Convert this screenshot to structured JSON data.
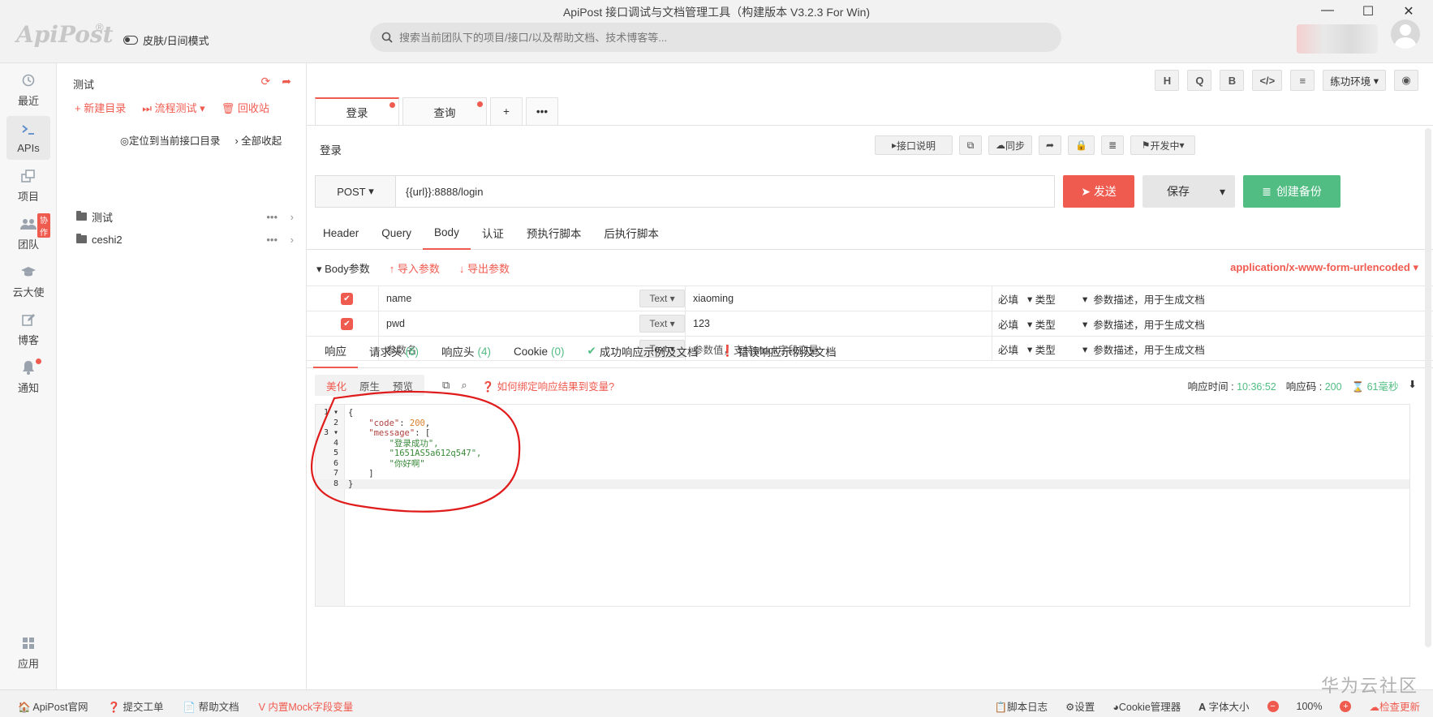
{
  "window": {
    "title": "ApiPost 接口调试与文档管理工具（构建版本 V3.2.3 For Win)",
    "minimize": "—",
    "maximize": "☐",
    "close": "✕"
  },
  "header": {
    "logo": "ApiPost",
    "logo_mark": "®",
    "skin_label": "皮肤/日间模式",
    "search_placeholder": "搜索当前团队下的项目/接口/以及帮助文档、技术博客等..."
  },
  "leftnav": {
    "items": [
      {
        "label": "最近",
        "icon": "clock-icon"
      },
      {
        "label": "APIs",
        "icon": "terminal-icon"
      },
      {
        "label": "项目",
        "icon": "project-icon"
      },
      {
        "label": "团队",
        "icon": "team-icon",
        "badge": "协作"
      },
      {
        "label": "云大使",
        "icon": "graduation-cap-icon"
      },
      {
        "label": "博客",
        "icon": "edit-icon"
      },
      {
        "label": "通知",
        "icon": "bell-icon"
      },
      {
        "label": "应用",
        "icon": "grid-icon"
      }
    ]
  },
  "tree": {
    "title": "测试",
    "new_dir": "新建目录",
    "flow_test": "流程测试",
    "recycle": "回收站",
    "locate": "定位到当前接口目录",
    "collapse": "全部收起",
    "folders": [
      "测试",
      "ceshi2"
    ]
  },
  "toolbar": {
    "buttons": [
      "H",
      "Q",
      "B",
      "</>",
      "≡"
    ],
    "env": "练功环境"
  },
  "tabs": [
    {
      "label": "登录"
    },
    {
      "label": "查询"
    }
  ],
  "tab_add": "+",
  "tab_more": "•••",
  "api": {
    "name": "登录",
    "doc_btn": "接口说明",
    "sync_btn": "同步",
    "status": "开发中",
    "method": "POST",
    "url": "{{url}}:8888/login",
    "send": "发送",
    "save": "保存",
    "backup": "创建备份"
  },
  "req_tabs": [
    "Header",
    "Query",
    "Body",
    "认证",
    "预执行脚本",
    "后执行脚本"
  ],
  "body": {
    "title": "Body参数",
    "import": "导入参数",
    "export": "导出参数",
    "content_type": "application/x-www-form-urlencoded",
    "rows": [
      {
        "checked": true,
        "name": "name",
        "type": "Text",
        "value": "xiaoming",
        "required": "必填",
        "vtype": "类型",
        "desc": "参数描述，用于生成文档"
      },
      {
        "checked": true,
        "name": "pwd",
        "type": "Text",
        "value": "123",
        "required": "必填",
        "vtype": "类型",
        "desc": "参数描述，用于生成文档"
      },
      {
        "checked": false,
        "name": "参数名",
        "type": "Text",
        "value": "参数值，支持Mock字段变量",
        "required": "必填",
        "vtype": "类型",
        "desc": "参数描述，用于生成文档"
      }
    ]
  },
  "resp_tabs": {
    "response": "响应",
    "req_headers": "请求头",
    "req_headers_count": "(6)",
    "resp_headers": "响应头",
    "resp_headers_count": "(4)",
    "cookie": "Cookie",
    "cookie_count": "(0)",
    "success_doc": "成功响应示例及文档",
    "error_doc": "错误响应示例及文档"
  },
  "view": {
    "modes": [
      "美化",
      "原生",
      "预览"
    ],
    "bind_help": "如何绑定响应结果到变量?",
    "time_label": "响应时间 : ",
    "time_value": "10:36:52",
    "code_label": "响应码 : ",
    "code_value": "200",
    "duration": "61毫秒"
  },
  "code_lines": [
    "{",
    "    \"code\": 200,",
    "    \"message\": [",
    "        \"登录成功\",",
    "        \"1651AS5a612q547\",",
    "        \"你好啊\"",
    "    ]",
    "}"
  ],
  "statusbar": {
    "official": "ApiPost官网",
    "ticket": "提交工单",
    "help": "帮助文档",
    "mock": "内置Mock字段变量",
    "script_log": "脚本日志",
    "settings": "设置",
    "cookie_mgr": "Cookie管理器",
    "font_size": "字体大小",
    "zoom": "100%",
    "update": "检查更新"
  },
  "watermark": "华为云社区",
  "colors": {
    "accent": "#f05b50",
    "success": "#52bd83",
    "annotation": "#e01b1b"
  }
}
